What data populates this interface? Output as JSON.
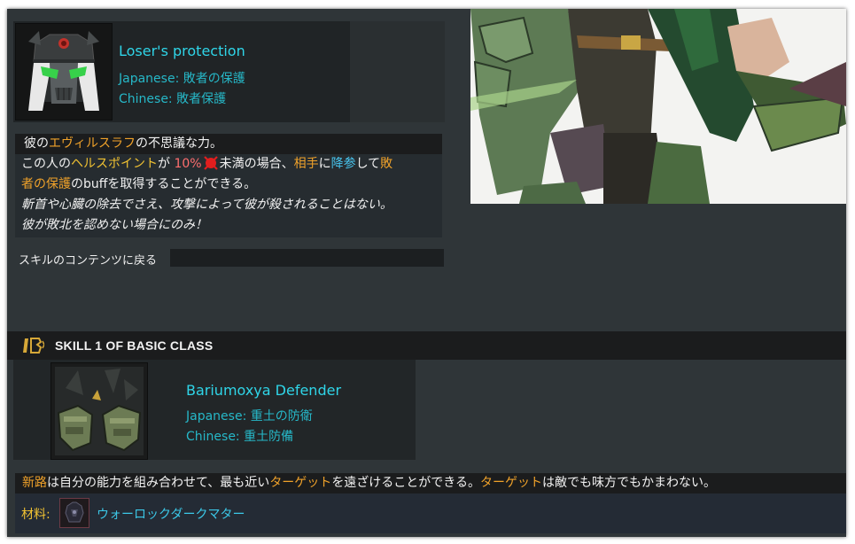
{
  "skill_top": {
    "name": "Loser's protection",
    "japanese_label": "Japanese:",
    "japanese_value": "敗者の保護",
    "chinese_label": "Chinese:",
    "chinese_value": "敗者保護"
  },
  "description_top": {
    "line1_pre": "彼の",
    "line1_hl": "エヴィルスラフ",
    "line1_post": "の不思議な力。",
    "line2_a": "この人の",
    "line2_hl1": "ヘルスポイント",
    "line2_b": "が ",
    "line2_pct": "10%",
    "line2_c": "未満の場合、",
    "line2_hl2": "相手",
    "line2_d": "に",
    "line2_hl3": "降参",
    "line2_e": "して",
    "line2_hl4a": "敗",
    "line3_hl4b": "者の保護",
    "line3_post": "のbuffを取得することができる。",
    "line4": "斬首や心臓の除去でさえ、攻撃によって彼が殺されることはない。",
    "line5": "彼が敗北を認めない場合にのみ！"
  },
  "back_link": "スキルのコンテンツに戻る",
  "section": {
    "title": "SKILL 1 OF BASIC CLASS"
  },
  "skill_one": {
    "name": "Bariumoxya Defender",
    "japanese_label": "Japanese:",
    "japanese_value": "重土の防衛",
    "chinese_label": "Chinese:",
    "chinese_value": "重土防備"
  },
  "description_one": {
    "hl1": "新路",
    "a": "は自分の能力を組み合わせて、最も近い",
    "hl2": "ターゲット",
    "b": "を遠ざけることができる。",
    "hl3": "ターゲット",
    "c": "は敵でも味方でもかまわない。"
  },
  "material": {
    "label": "材料:",
    "name": "ウォーロックダークマター"
  },
  "colors": {
    "accent_cyan": "#2fd5e8",
    "highlight_orange": "#f0a22a",
    "highlight_yellow": "#f1c232",
    "background": "#2f3538"
  }
}
